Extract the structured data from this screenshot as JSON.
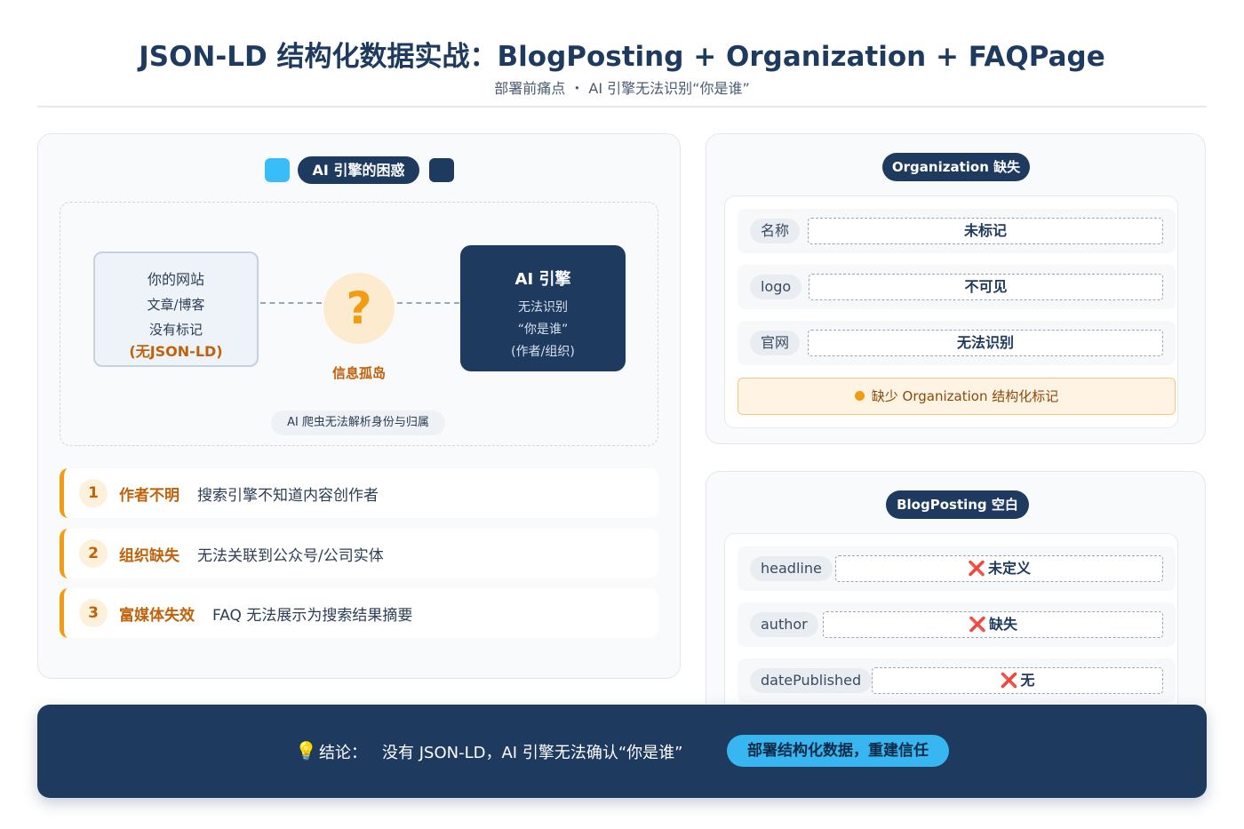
{
  "header": {
    "title": "JSON-LD 结构化数据实战：BlogPosting + Organization + FAQPage",
    "subtitle": "部署前痛点 ・ AI 引擎无法识别“你是谁”"
  },
  "left_panel": {
    "heading": "AI 引擎的困惑",
    "colors": {
      "accent_light": "#38bdf8",
      "accent_dark": "#1e3a5f",
      "warning": "#f39c12"
    },
    "site": {
      "line1": "你的网站",
      "line2": "文章/博客",
      "line3": "没有标记",
      "line4": "(无JSON-LD)"
    },
    "question": {
      "symbol": "?",
      "label": "信息孤岛"
    },
    "engine": {
      "title": "AI 引擎",
      "line1": "无法识别",
      "line2": "“你是谁”",
      "line3": "(作者/组织)"
    },
    "crawler_note": "AI 爬虫无法解析身份与归属",
    "issues": [
      {
        "num": "1",
        "label": "作者不明",
        "desc": "搜索引擎不知道内容创作者"
      },
      {
        "num": "2",
        "label": "组织缺失",
        "desc": "无法关联到公众号/公司实体"
      },
      {
        "num": "3",
        "label": "富媒体失效",
        "desc": "FAQ 无法展示为搜索结果摘要"
      }
    ]
  },
  "org_panel": {
    "heading": "Organization 缺失",
    "fields": [
      {
        "key": "名称",
        "value": "未标记"
      },
      {
        "key": "logo",
        "value": "不可见"
      },
      {
        "key": "官网",
        "value": "无法识别"
      }
    ],
    "warning": "缺少 Organization 结构化标记"
  },
  "blog_panel": {
    "heading": "BlogPosting 空白",
    "cross_icon": "❌",
    "fields": [
      {
        "key": "headline",
        "value": "未定义"
      },
      {
        "key": "author",
        "value": "缺失"
      },
      {
        "key": "datePublished",
        "value": "无"
      }
    ]
  },
  "footer": {
    "icon": "💡",
    "label": "结论：",
    "text": "没有 JSON-LD，AI 引擎无法确认“你是谁”",
    "cta": "部署结构化数据，重建信任"
  }
}
